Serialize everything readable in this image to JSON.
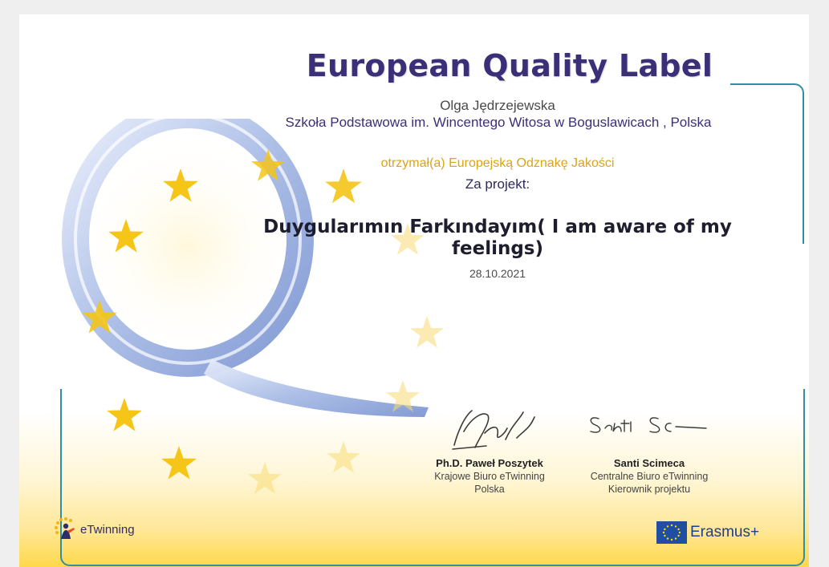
{
  "certificate": {
    "title": "European Quality Label",
    "teacher_name": "Olga Jędrzejewska",
    "school": "Szkoła Podstawowa im. Wincentego Witosa w Boguslawicach , Polska",
    "received_text": "otrzymał(a) Europejską Odznakę Jakości",
    "for_project_label": "Za projekt:",
    "project_name": "Duygularımın Farkındayım( I am aware of my feelings)",
    "date": "28.10.2021"
  },
  "signatories": [
    {
      "signature_script": "Ppoxyk",
      "name": "Ph.D. Paweł Poszytek",
      "line1": "Krajowe Biuro eTwinning",
      "line2": "Polska"
    },
    {
      "signature_script": "Santi Sci",
      "name": "Santi Scimeca",
      "line1": "Centralne Biuro eTwinning",
      "line2": "Kierownik projektu"
    }
  ],
  "logos": {
    "etwinning_label": "eTwinning",
    "erasmus_label": "Erasmus+"
  },
  "colors": {
    "title": "#3b2f78",
    "accent_gold": "#d9a41a",
    "frame": "#2f8fa5",
    "star": "#f5c518"
  }
}
